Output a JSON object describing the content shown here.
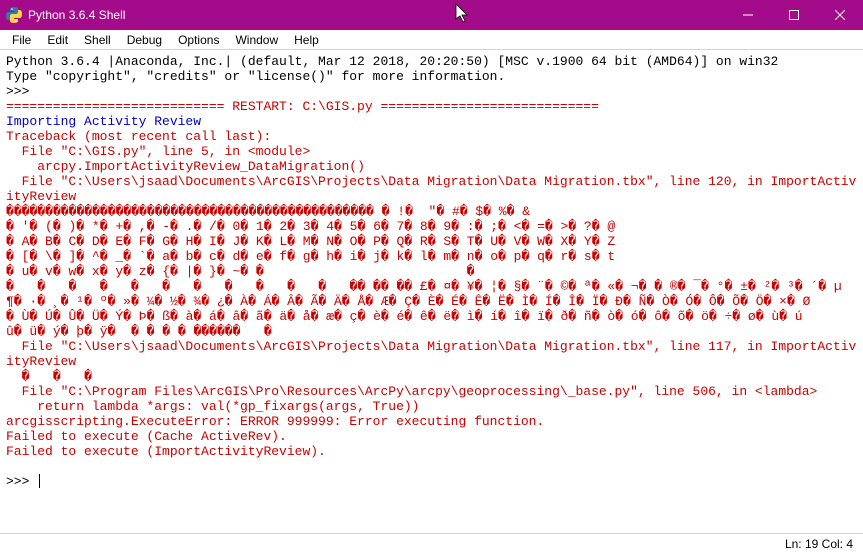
{
  "window": {
    "title": "Python 3.6.4 Shell"
  },
  "menu": {
    "items": [
      "File",
      "Edit",
      "Shell",
      "Debug",
      "Options",
      "Window",
      "Help"
    ]
  },
  "lines": {
    "l1": "Python 3.6.4 |Anaconda, Inc.| (default, Mar 12 2018, 20:20:50) [MSC v.1900 64 bit (AMD64)] on win32",
    "l2": "Type \"copyright\", \"credits\" or \"license()\" for more information.",
    "prompt1": ">>> ",
    "restart": "============================ RESTART: C:\\GIS.py ============================",
    "importing": "Importing Activity Review",
    "tb1": "Traceback (most recent call last):",
    "tb2": "  File \"C:\\GIS.py\", line 5, in <module>",
    "tb3": "    arcpy.ImportActivityReview_DataMigration()",
    "tb4": "  File \"C:\\Users\\jsaad\\Documents\\ArcGIS\\Projects\\Data Migration\\Data Migration.tbx\", line 120, in ImportActivityReview",
    "garble1": "����������������������������������������������� � !�  \"� #� $� %� &",
    "garble2": "� '� (� )� *� +� ,� -� .� /� 0� 1� 2� 3� 4� 5� 6� 7� 8� 9� :� ;� <� =� >� ?� @",
    "garble3": "� A� B� C� D� E� F� G� H� I� J� K� L� M� N� O� P� Q� R� S� T� U� V� W� X� Y� Z",
    "garble4": "� [� \\� ]� ^� _� `� a� b� c� d� e� f� g� h� i� j� k� l� m� n� o� p� q� r� s� t",
    "garble5": "� u� v� w� x� y� z� {� |� }� ~� �                          �",
    "garble6": "�   �   �   �   �   �   �   �   �   �   �   �� �� �� £� ¤� ¥� ¦� §� ¨� ©� ª� «� ¬� ­� ®� ¯� °� ±� ²� ³� ´� µ",
    "garble7": "¶� ·� ¸� ¹� º� »� ¼� ½� ¾� ¿� À� Á� Â� Ã� Ä� Å� Æ� Ç� È� É� Ê� Ë� Ì� Í� Î� Ï� Ð� Ñ� Ò� Ó� Ô� Õ� Ö� ×� Ø",
    "garble8": "� Ù� Ú� Û� Ü� Ý� Þ� ß� à� á� â� ã� ä� å� æ� ç� è� é� ê� ë� ì� í� î� ï� ð� ñ� ò� ó� ô� õ� ö� ÷� ø� ù� ú",
    "garble9": "û� ü� ý� þ� ÿ�  � � � � ������   �",
    "tb5": "  File \"C:\\Users\\jsaad\\Documents\\ArcGIS\\Projects\\Data Migration\\Data Migration.tbx\", line 117, in ImportActivityReview",
    "garble10": "  �   �   �",
    "tb6": "  File \"C:\\Program Files\\ArcGIS\\Pro\\Resources\\ArcPy\\arcpy\\geoprocessing\\_base.py\", line 506, in <lambda>",
    "tb7": "    return lambda *args: val(*gp_fixargs(args, True))",
    "err1": "arcgisscripting.ExecuteError: ERROR 999999: Error executing function.",
    "err2": "Failed to execute (Cache ActiveRev).",
    "err3": "Failed to execute (ImportActivityReview).",
    "blank": "",
    "prompt2": ">>> "
  },
  "status": {
    "pos": "Ln: 19  Col: 4"
  }
}
